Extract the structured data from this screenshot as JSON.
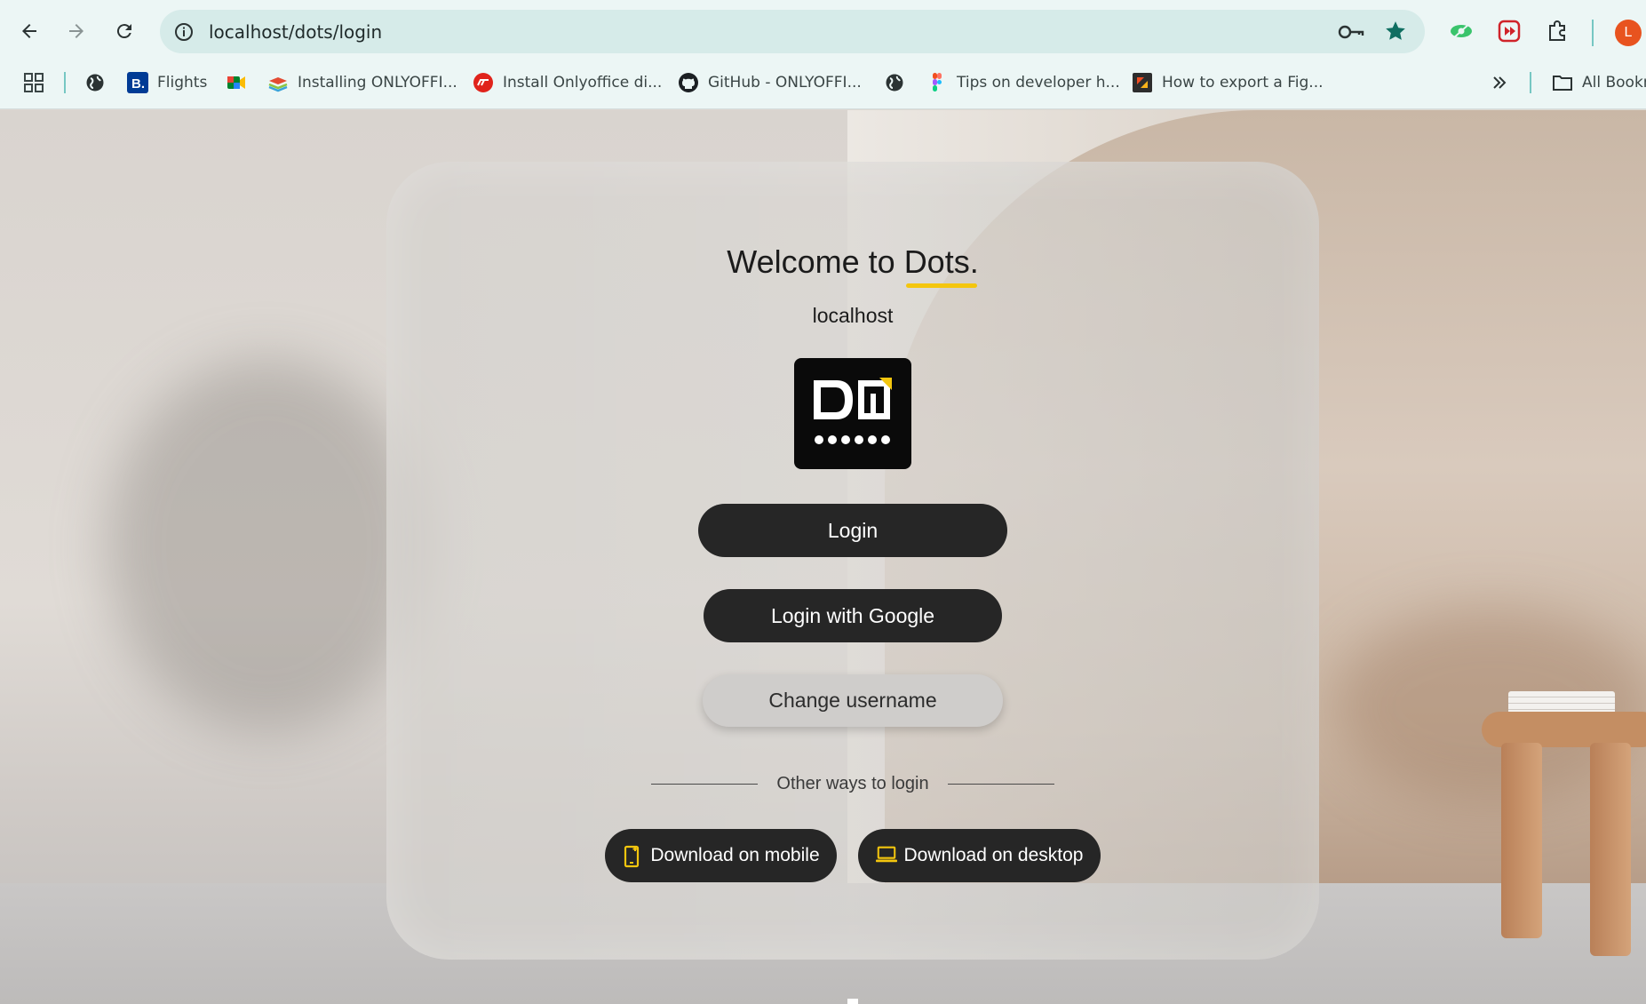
{
  "browser": {
    "url": "localhost/dots/login",
    "profile_initial": "L",
    "bookmarks": [
      {
        "label": "Flights",
        "icon": "booking-icon"
      },
      {
        "label": "",
        "icon": "google-meet-icon"
      },
      {
        "label": "Installing ONLYOFFI...",
        "icon": "onlyoffice-icon"
      },
      {
        "label": "Install Onlyoffice di...",
        "icon": "red-circle-icon"
      },
      {
        "label": "GitHub - ONLYOFFI...",
        "icon": "github-icon"
      },
      {
        "label": "",
        "icon": "globe-icon"
      },
      {
        "label": "Tips on developer h...",
        "icon": "figma-icon"
      },
      {
        "label": "How to export a Fig...",
        "icon": "export-icon"
      }
    ],
    "all_bookmarks": "All Bookm"
  },
  "colors": {
    "accent_yellow": "#f4c60e",
    "button_dark": "#262626",
    "button_light": "#cfcdcb"
  },
  "login": {
    "welcome_prefix": "Welcome to",
    "brand": "Dots.",
    "host": "localhost",
    "login_label": "Login",
    "google_label": "Login with Google",
    "change_username_label": "Change username",
    "other_ways": "Other ways to login",
    "download_mobile": "Download on mobile",
    "download_desktop": "Download on desktop"
  }
}
